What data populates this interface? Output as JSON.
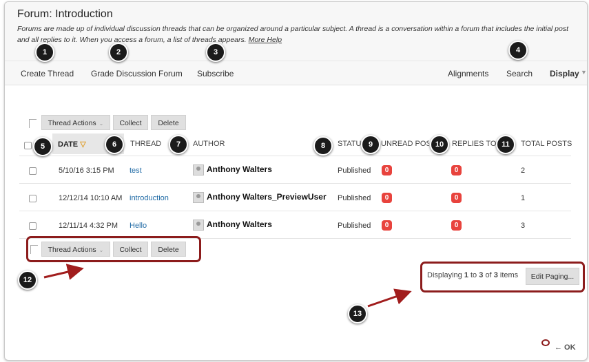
{
  "forum": {
    "title": "Forum: Introduction",
    "description": "Forums are made up of individual discussion threads that can be organized around a particular subject. A thread is a conversation within a forum that includes the initial post and all replies to it. When you access a forum, a list of threads appears.",
    "more_help": "More Help"
  },
  "nav": {
    "create_thread": "Create Thread",
    "grade_forum": "Grade Discussion Forum",
    "subscribe": "Subscribe",
    "alignments": "Alignments",
    "search": "Search",
    "display": "Display"
  },
  "actions": {
    "thread_actions": "Thread Actions",
    "collect": "Collect",
    "delete": "Delete"
  },
  "columns": {
    "date": "DATE",
    "thread": "THREAD",
    "author": "AUTHOR",
    "status": "STATUS",
    "unread": "UNREAD POSTS",
    "replies": "REPLIES TO ME",
    "total": "TOTAL POSTS"
  },
  "rows": [
    {
      "date": "5/10/16 3:15 PM",
      "thread": "test",
      "author": "Anthony Walters",
      "status": "Published",
      "unread": "0",
      "replies": "0",
      "total": "2"
    },
    {
      "date": "12/12/14 10:10 AM",
      "thread": "introduction",
      "author": "Anthony Walters_PreviewUser",
      "status": "Published",
      "unread": "0",
      "replies": "0",
      "total": "1"
    },
    {
      "date": "12/11/14 4:32 PM",
      "thread": "Hello",
      "author": "Anthony Walters",
      "status": "Published",
      "unread": "0",
      "replies": "0",
      "total": "3"
    }
  ],
  "paging": {
    "prefix": "Displaying",
    "from": "1",
    "to_word": "to",
    "to": "3",
    "of_word": "of",
    "total": "3",
    "suffix": "items",
    "edit": "Edit Paging..."
  },
  "ok": "← OK",
  "callouts": [
    "1",
    "2",
    "3",
    "4",
    "5",
    "6",
    "7",
    "8",
    "9",
    "10",
    "11",
    "12",
    "13"
  ],
  "colors": {
    "badge": "#e8433d",
    "callout": "#1b1b1b",
    "highlight_box": "#8c1c1c",
    "link": "#1f6aa5",
    "sort_arrow": "#e0a030"
  }
}
